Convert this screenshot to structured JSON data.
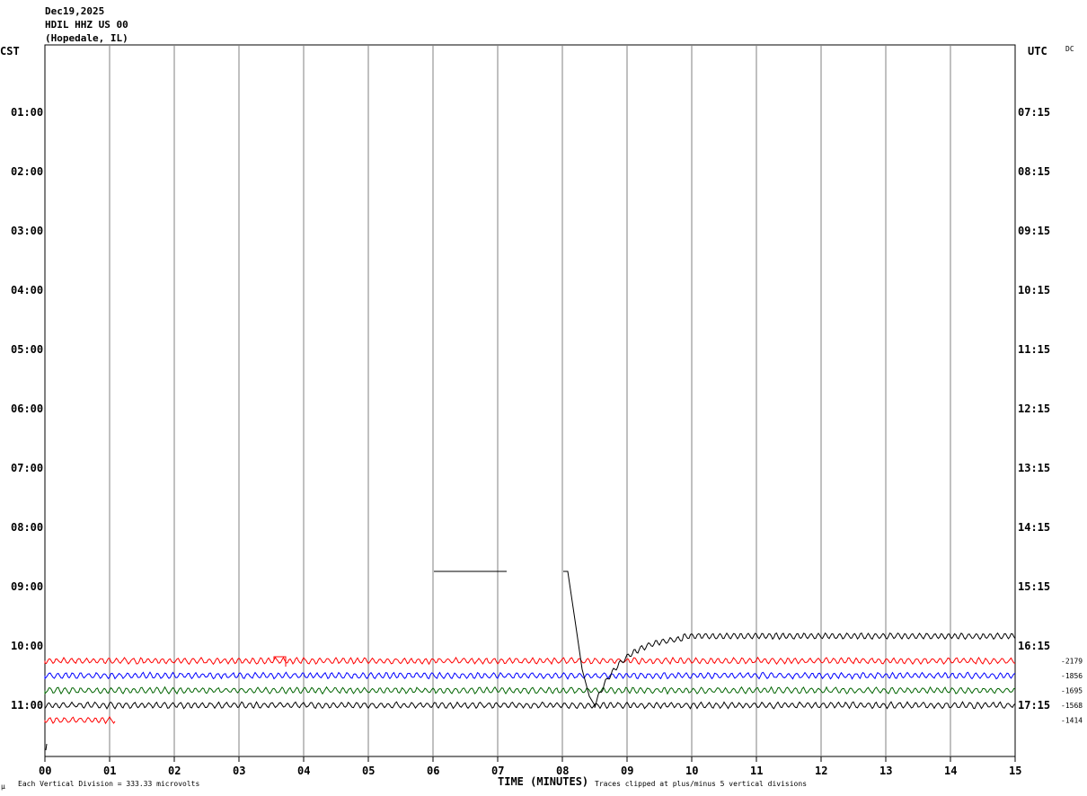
{
  "header": {
    "date": "Dec19,2025",
    "station": "HDIL HHZ US 00",
    "location": "(Hopedale, IL)",
    "left_tz": "CST",
    "right_tz": "UTC",
    "dc_label": "DC"
  },
  "footer": {
    "scale_note": "Each Vertical Division =  333.33 microvolts",
    "clip_note": "Traces clipped at plus/minus 5 vertical divisions",
    "corner_mark": "μ"
  },
  "chart_data": {
    "type": "line",
    "title": "",
    "xlabel": "TIME (MINUTES)",
    "xlim": [
      0,
      15
    ],
    "x_ticks": [
      "00",
      "01",
      "02",
      "03",
      "04",
      "05",
      "06",
      "07",
      "08",
      "09",
      "10",
      "11",
      "12",
      "13",
      "14",
      "15"
    ],
    "grid": "vertical",
    "left_ticks": [
      "01:00",
      "02:00",
      "03:00",
      "04:00",
      "05:00",
      "06:00",
      "07:00",
      "08:00",
      "09:00",
      "10:00",
      "11:00"
    ],
    "right_ticks": [
      "07:15",
      "08:15",
      "09:15",
      "10:15",
      "11:15",
      "12:15",
      "13:15",
      "14:15",
      "15:15",
      "16:15",
      "17:15"
    ],
    "traces": [
      {
        "start_cst": "10:15",
        "color": "#ff0000",
        "minutes": 15,
        "dc_offset": "-2179"
      },
      {
        "start_cst": "10:30",
        "color": "#0000ff",
        "minutes": 15,
        "dc_offset": "-1856"
      },
      {
        "start_cst": "10:45",
        "color": "#006400",
        "minutes": 15,
        "dc_offset": "-1695"
      },
      {
        "start_cst": "11:00",
        "color": "#000000",
        "minutes": 15,
        "dc_offset": "-1568"
      },
      {
        "start_cst": "11:15",
        "color": "#ff0000",
        "minutes": 1.1,
        "dc_offset": "-1414"
      }
    ]
  }
}
